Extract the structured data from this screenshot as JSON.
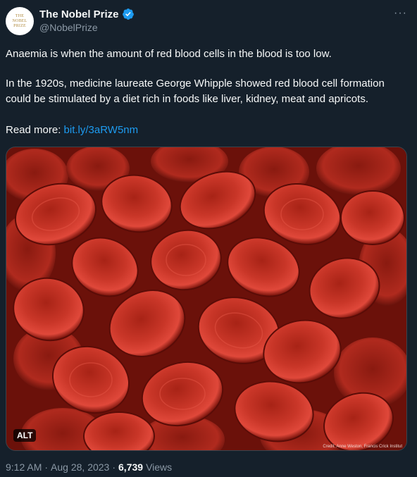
{
  "account": {
    "display_name": "The Nobel Prize",
    "handle": "@NobelPrize",
    "avatar_lines": [
      "THE",
      "NOBEL",
      "PRIZE"
    ],
    "verified_icon": "verified-badge-icon",
    "more_icon": "more-options-icon",
    "more_label": "···"
  },
  "tweet": {
    "paragraph_1": "Anaemia is when the amount of red blood cells in the blood is too low.",
    "paragraph_2": "In the 1920s, medicine laureate George Whipple showed red blood cell formation could be stimulated by a diet rich in foods like liver, kidney, meat and apricots.",
    "read_more_label": "Read more:",
    "link_text": "bit.ly/3aRW5nm"
  },
  "media": {
    "alt_label": "ALT",
    "credit": "Credit: Anne Weston, Francis Crick Institut"
  },
  "meta": {
    "time": "9:12 AM",
    "separator": "·",
    "date": "Aug 28, 2023",
    "views_count": "6,739",
    "views_label": "Views"
  },
  "colors": {
    "background": "#15202b",
    "link": "#1d9bf0",
    "secondary_text": "#8b98a5",
    "verified": "#1d9bf0"
  }
}
